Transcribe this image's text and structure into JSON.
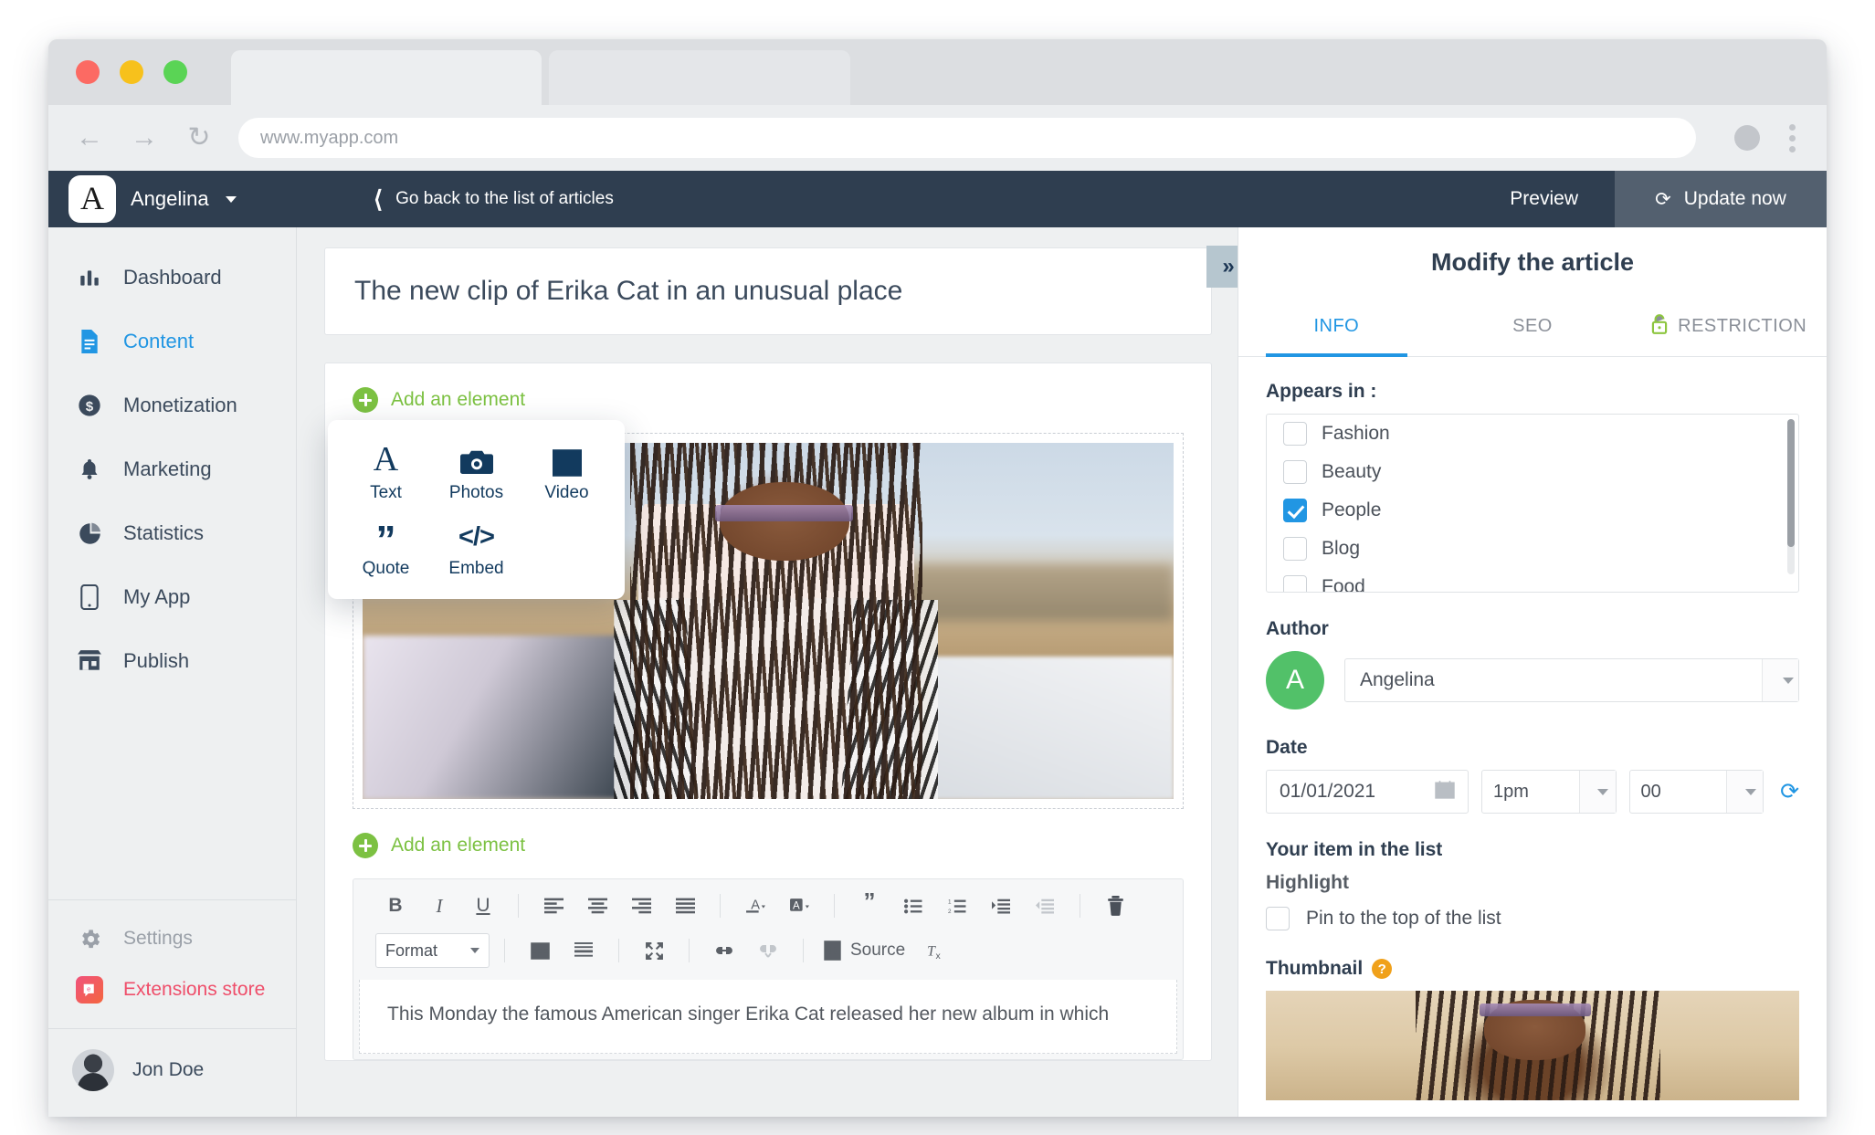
{
  "browser": {
    "url": "www.myapp.com",
    "back_icon": "back-arrow-icon",
    "forward_icon": "forward-arrow-icon",
    "reload_icon": "reload-icon"
  },
  "topbar": {
    "logo_letter": "A",
    "account_name": "Angelina",
    "back_link": "Go back to the list of articles",
    "preview_label": "Preview",
    "update_label": "Update now"
  },
  "sidebar": {
    "items": [
      {
        "label": "Dashboard",
        "icon": "bar-chart-icon",
        "active": false
      },
      {
        "label": "Content",
        "icon": "document-icon",
        "active": true
      },
      {
        "label": "Monetization",
        "icon": "dollar-circle-icon",
        "active": false
      },
      {
        "label": "Marketing",
        "icon": "bell-icon",
        "active": false
      },
      {
        "label": "Statistics",
        "icon": "pie-chart-icon",
        "active": false
      },
      {
        "label": "My App",
        "icon": "mobile-phone-icon",
        "active": false
      },
      {
        "label": "Publish",
        "icon": "storefront-icon",
        "active": false
      }
    ],
    "settings_label": "Settings",
    "extensions_label": "Extensions store",
    "user_name": "Jon Doe"
  },
  "editor": {
    "article_title": "The new clip of Erika Cat in an unusual place",
    "add_element_label": "Add an element",
    "add_element_label_2": "Add an element",
    "popup": {
      "items": [
        {
          "label": "Text",
          "icon": "text-A-icon"
        },
        {
          "label": "Photos",
          "icon": "camera-icon"
        },
        {
          "label": "Video",
          "icon": "film-strip-icon"
        },
        {
          "label": "Quote",
          "icon": "quote-marks-icon"
        },
        {
          "label": "Embed",
          "icon": "code-brackets-icon"
        }
      ]
    },
    "toolbar": {
      "bold": "B",
      "italic": "I",
      "underline": "U",
      "format_label": "Format",
      "source_label": "Source"
    },
    "body_text": "This Monday the famous American singer Erika Cat released her new album in which",
    "collapse_icon": "double-chevron-right-icon"
  },
  "right_panel": {
    "title": "Modify the article",
    "tabs": [
      {
        "label": "INFO",
        "active": true
      },
      {
        "label": "SEO",
        "active": false
      },
      {
        "label": "RESTRICTION",
        "active": false,
        "icon": "unlock-icon"
      }
    ],
    "appears_in_label": "Appears in :",
    "categories": [
      {
        "label": "Fashion",
        "checked": false
      },
      {
        "label": "Beauty",
        "checked": false
      },
      {
        "label": "People",
        "checked": true
      },
      {
        "label": "Blog",
        "checked": false
      },
      {
        "label": "Food",
        "checked": false
      }
    ],
    "author_label": "Author",
    "author_initial": "A",
    "author_value": "Angelina",
    "date_label": "Date",
    "date_value": "01/01/2021",
    "hour_value": "1pm",
    "minute_value": "00",
    "list_section_label": "Your item in the list",
    "highlight_label": "Highlight",
    "pin_label": "Pin to the top of the list",
    "thumbnail_label": "Thumbnail"
  },
  "colors": {
    "accent_blue": "#2196e3",
    "navy": "#2f3e50",
    "green": "#7cc142",
    "author_green": "#52c169",
    "pink": "#ef4e6a",
    "orange": "#f0a11b"
  }
}
